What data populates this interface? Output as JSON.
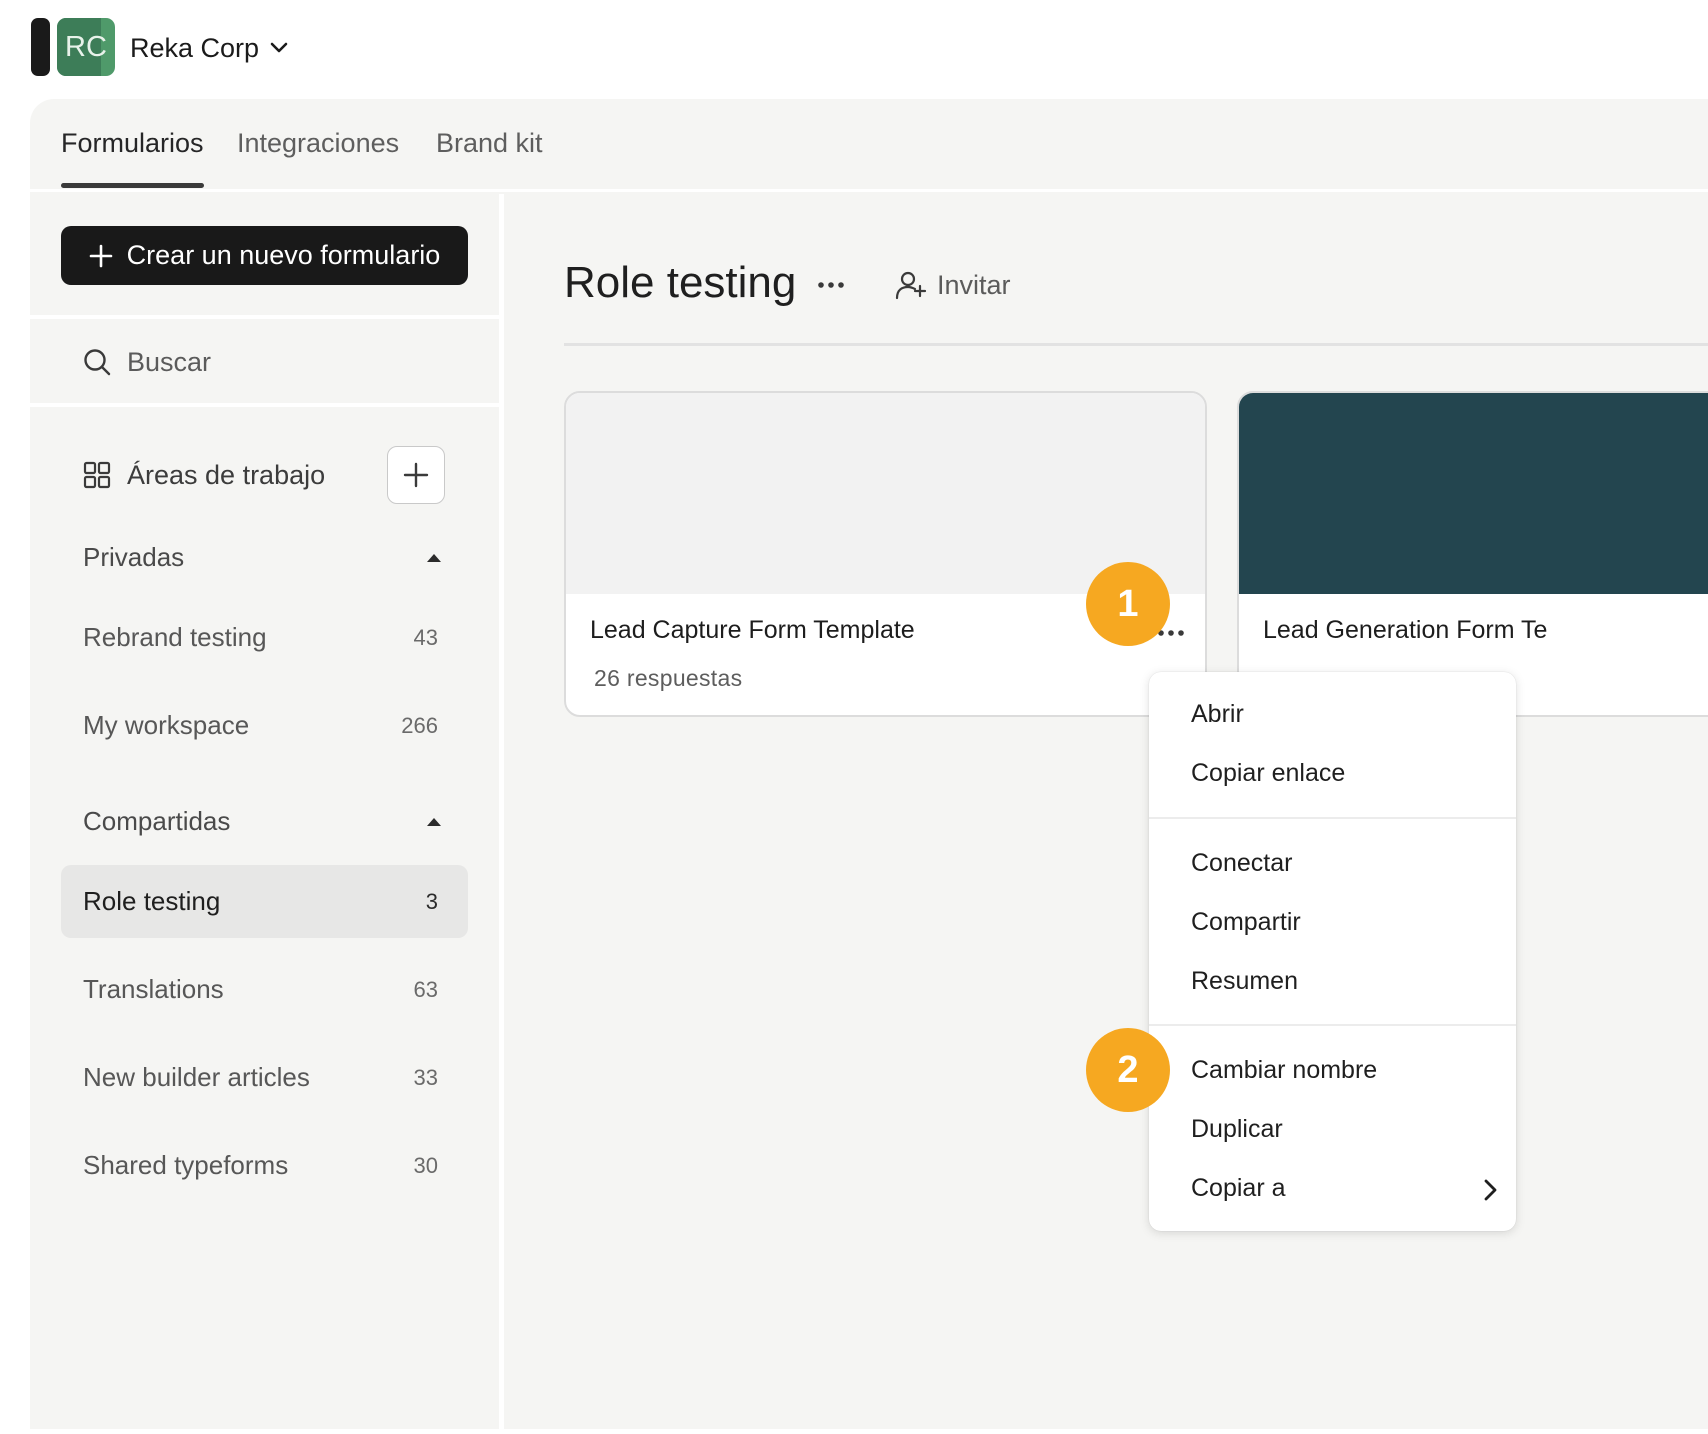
{
  "org": {
    "initials": "RC",
    "name": "Reka Corp",
    "avatar_color": "#4f9a6a"
  },
  "tabs": [
    {
      "label": "Formularios",
      "active": true
    },
    {
      "label": "Integraciones",
      "active": false
    },
    {
      "label": "Brand kit",
      "active": false
    }
  ],
  "sidebar": {
    "create_label": "Crear un nuevo formulario",
    "search_label": "Buscar",
    "workspaces_label": "Áreas de trabajo",
    "private_label": "Privadas",
    "private_items": [
      {
        "name": "Rebrand testing",
        "count": "43"
      },
      {
        "name": "My workspace",
        "count": "266"
      }
    ],
    "shared_label": "Compartidas",
    "shared_items": [
      {
        "name": "Role testing",
        "count": "3",
        "active": true
      },
      {
        "name": "Translations",
        "count": "63"
      },
      {
        "name": "New builder articles",
        "count": "33"
      },
      {
        "name": "Shared typeforms",
        "count": "30"
      }
    ]
  },
  "content": {
    "title": "Role testing",
    "invite_label": "Invitar",
    "cards": [
      {
        "title": "Lead Capture Form Template",
        "responses": "26 respuestas",
        "thumb_color": "#f2f2f2"
      },
      {
        "title": "Lead Generation Form Te",
        "thumb_color": "#23454f"
      }
    ]
  },
  "menu": {
    "items": [
      "Abrir",
      "Copiar enlace",
      "Conectar",
      "Compartir",
      "Resumen",
      "Cambiar nombre",
      "Duplicar",
      "Copiar a"
    ]
  },
  "badges": [
    "1",
    "2"
  ],
  "colors": {
    "accent_badge": "#f6a821",
    "primary_button": "#191919",
    "panel_bg": "#f5f5f3"
  }
}
